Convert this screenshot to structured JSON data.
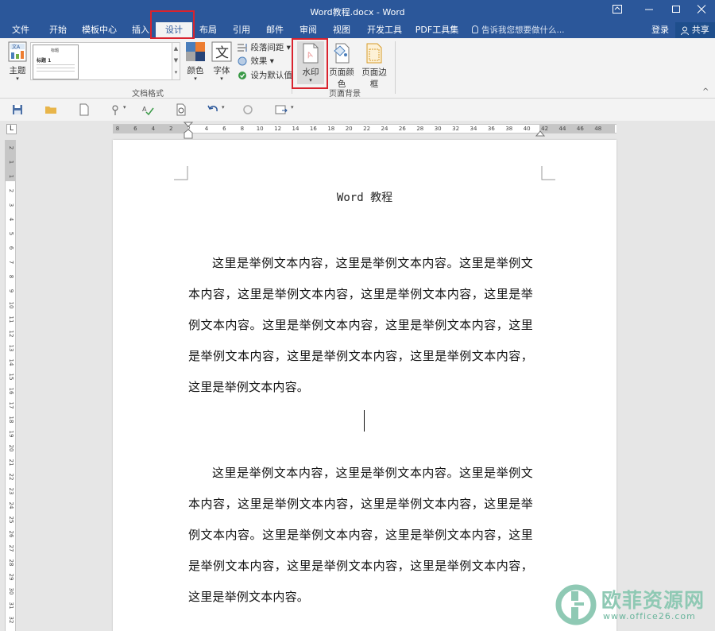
{
  "window": {
    "title": "Word教程.docx - Word"
  },
  "tabs": [
    {
      "label": "文件"
    },
    {
      "label": "开始"
    },
    {
      "label": "模板中心"
    },
    {
      "label": "插入"
    },
    {
      "label": "设计"
    },
    {
      "label": "布局"
    },
    {
      "label": "引用"
    },
    {
      "label": "邮件"
    },
    {
      "label": "审阅"
    },
    {
      "label": "视图"
    },
    {
      "label": "开发工具"
    },
    {
      "label": "PDF工具集"
    }
  ],
  "tell_me": "告诉我您想要做什么...",
  "account": {
    "login": "登录",
    "share": "共享"
  },
  "ribbon": {
    "theme": "主题",
    "gallery": {
      "item_heading": "标题",
      "item_title": "标题 1"
    },
    "colors": "颜色",
    "fonts": "字体",
    "paragraph_spacing": "段落间距",
    "effects": "效果",
    "set_default": "设为默认值",
    "group_document_format": "文档格式",
    "watermark": "水印",
    "page_color": "页面颜色",
    "page_borders": "页面边框",
    "group_page_background": "页面背景"
  },
  "ruler": {
    "h_labels": [
      "8",
      "6",
      "4",
      "2",
      "2",
      "4",
      "6",
      "8",
      "10",
      "12",
      "14",
      "16",
      "18",
      "20",
      "22",
      "24",
      "26",
      "28",
      "30",
      "32",
      "34",
      "36",
      "38",
      "40",
      "42",
      "44",
      "46",
      "48"
    ],
    "v_labels": [
      "2",
      "1",
      "1",
      "2",
      "3",
      "4",
      "5",
      "6",
      "7",
      "8",
      "9",
      "10",
      "11",
      "12",
      "13",
      "14",
      "15",
      "16",
      "17",
      "18",
      "19",
      "20",
      "21",
      "22",
      "23",
      "24",
      "25",
      "26",
      "27",
      "28",
      "29",
      "30",
      "31",
      "32"
    ],
    "corner": "L"
  },
  "document": {
    "header": "Word 教程",
    "paragraphs": [
      "这里是举例文本内容，这里是举例文本内容。这里是举例文本内容，这里是举例文本内容，这里是举例文本内容，这里是举例文本内容。这里是举例文本内容，这里是举例文本内容，这里是举例文本内容，这里是举例文本内容，这里是举例文本内容，这里是举例文本内容。",
      "这里是举例文本内容，这里是举例文本内容。这里是举例文本内容，这里是举例文本内容，这里是举例文本内容，这里是举例文本内容。这里是举例文本内容，这里是举例文本内容，这里是举例文本内容，这里是举例文本内容，这里是举例文本内容，这里是举例文本内容。"
    ]
  },
  "brand": {
    "name": "欧菲资源网",
    "url": "www.office26.com"
  },
  "colors": {
    "accent": "#2b579a",
    "highlight": "#d9232e"
  }
}
